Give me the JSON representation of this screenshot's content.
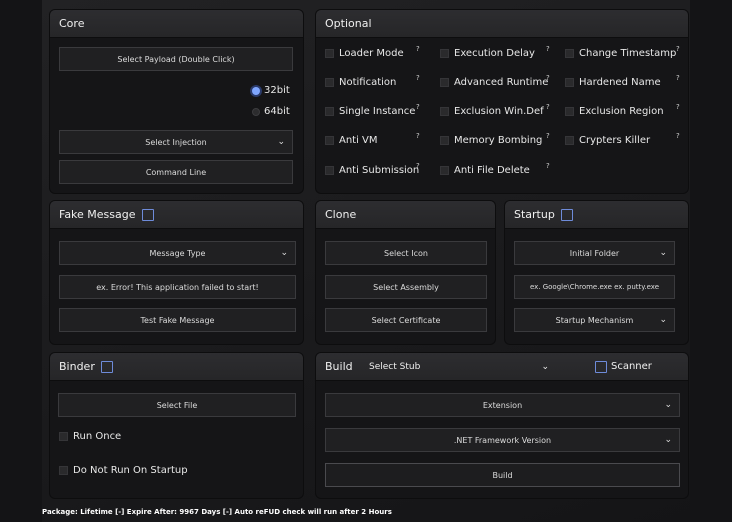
{
  "core": {
    "title": "Core",
    "select_payload": "Select Payload   (Double Click)",
    "arch": [
      "32bit",
      "64bit"
    ],
    "select_injection": "Select Injection",
    "command_line": "Command Line"
  },
  "optional": {
    "title": "Optional",
    "options": [
      [
        "Loader Mode",
        "Execution Delay",
        "Change Timestamp"
      ],
      [
        "Notification",
        "Advanced Runtime",
        "Hardened Name"
      ],
      [
        "Single Instance",
        "Exclusion Win.Def",
        "Exclusion Region"
      ],
      [
        "Anti VM",
        "Memory Bombing",
        "Crypters Killer"
      ],
      [
        "Anti Submission",
        "Anti File Delete",
        ""
      ]
    ],
    "tip_mark": "?"
  },
  "fake_message": {
    "title": "Fake Message",
    "message_type": "Message Type",
    "message_placeholder": "ex. Error! This application failed to start!",
    "test_button": "Test Fake Message"
  },
  "clone": {
    "title": "Clone",
    "select_icon": "Select Icon",
    "select_assembly": "Select Assembly",
    "select_certificate": "Select Certificate"
  },
  "startup": {
    "title": "Startup",
    "initial_folder": "Initial Folder",
    "path_placeholder": "ex. Google\\Chrome.exe   ex. putty.exe",
    "mechanism": "Startup Mechanism"
  },
  "binder": {
    "title": "Binder",
    "select_file": "Select File",
    "run_once": "Run Once",
    "do_not_run": "Do Not Run On Startup"
  },
  "build": {
    "title": "Build",
    "select_stub": "Select Stub",
    "scanner": "Scanner",
    "extension": "Extension",
    "framework": ".NET Framework Version",
    "build_button": "Build"
  },
  "footer": "Package: Lifetime [-] Expire After: 9967 Days [-] Auto reFUD check will run after 2 Hours"
}
